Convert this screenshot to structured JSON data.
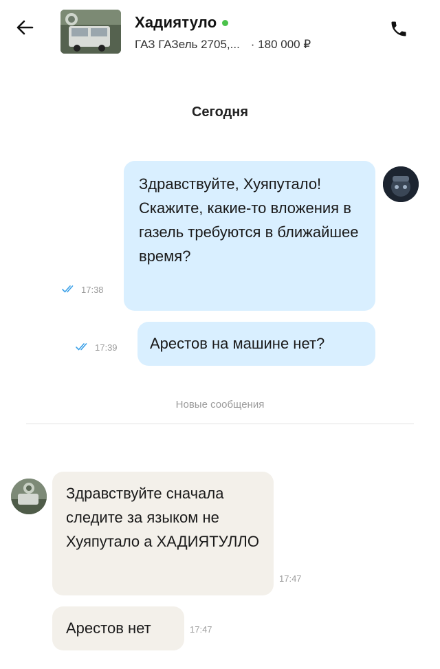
{
  "header": {
    "contact_name": "Хадиятуло",
    "listing_title": "ГАЗ ГАЗель 2705,...",
    "price": "· 180 000 ₽"
  },
  "chat": {
    "day_label": "Сегодня",
    "new_messages_label": "Новые сообщения",
    "messages": [
      {
        "direction": "outgoing",
        "text": "Здравствуйте, Хуяпутало! Скажите, какие-то вложения в газель требуются в ближайшее время?",
        "time": "17:38",
        "read": true
      },
      {
        "direction": "outgoing",
        "text": "Арестов на машине нет?",
        "time": "17:39",
        "read": true
      },
      {
        "direction": "incoming",
        "text": "Здравствуйте сначала следите за языком не Хуяпутало а ХАДИЯТУЛЛО",
        "time": "17:47"
      },
      {
        "direction": "incoming",
        "text": "Арестов нет",
        "time": "17:47"
      }
    ]
  },
  "icons": {
    "back": "arrow-left-icon",
    "phone": "phone-icon",
    "read_status": "double-check-icon"
  },
  "colors": {
    "outgoing_bubble": "#d9efff",
    "incoming_bubble": "#f3f0ea",
    "online_dot": "#4bc24b",
    "read_check": "#3aa0e8",
    "muted_text": "#9a9a9a"
  }
}
